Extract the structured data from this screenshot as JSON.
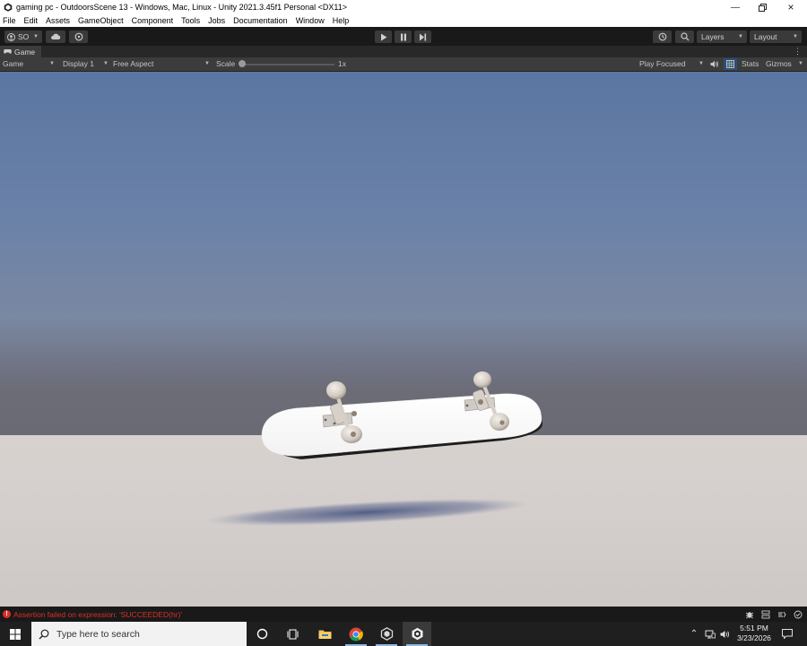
{
  "window": {
    "title": "gaming pc - OutdoorsScene 13 - Windows, Mac, Linux - Unity 2021.3.45f1 Personal <DX11>",
    "controls": [
      "minimize",
      "restore",
      "close"
    ]
  },
  "menu": {
    "items": [
      "File",
      "Edit",
      "Assets",
      "GameObject",
      "Component",
      "Tools",
      "Jobs",
      "Documentation",
      "Window",
      "Help"
    ]
  },
  "toolbar": {
    "account_label": "SO",
    "layers_label": "Layers",
    "layout_label": "Layout",
    "play_icon": "play-icon",
    "pause_icon": "pause-icon",
    "step_icon": "step-icon"
  },
  "tab": {
    "label": "Game"
  },
  "gameview": {
    "mode": "Game",
    "display": "Display 1",
    "aspect": "Free Aspect",
    "scale_label": "Scale",
    "scale_value": "1x",
    "play_mode": "Play Focused",
    "stats_label": "Stats",
    "gizmos_label": "Gizmos"
  },
  "status": {
    "message": "Assertion failed on expression: 'SUCCEEDED(hr)'",
    "level": "error",
    "error_color": "#d9302b"
  },
  "taskbar": {
    "search_placeholder": "Type here to search",
    "apps": [
      "cortana",
      "task-view",
      "file-explorer",
      "chrome",
      "unity-hub",
      "unity-editor"
    ],
    "time": "5:51 PM",
    "date": "3/23/2026"
  }
}
